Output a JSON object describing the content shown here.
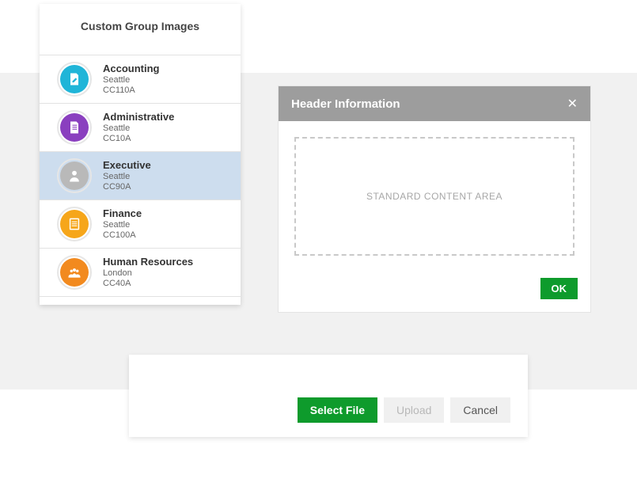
{
  "sidebar": {
    "title": "Custom Group Images",
    "selected_index": 2,
    "items": [
      {
        "name": "Accounting",
        "location": "Seattle",
        "code": "CC110A",
        "icon": "edit-doc",
        "color": "#20b5d8"
      },
      {
        "name": "Administrative",
        "location": "Seattle",
        "code": "CC10A",
        "icon": "document",
        "color": "#8a3fbf"
      },
      {
        "name": "Executive",
        "location": "Seattle",
        "code": "CC90A",
        "icon": "person",
        "color": "#b9b9b9"
      },
      {
        "name": "Finance",
        "location": "Seattle",
        "code": "CC100A",
        "icon": "list",
        "color": "#f6a61a"
      },
      {
        "name": "Human Resources",
        "location": "London",
        "code": "CC40A",
        "icon": "people",
        "color": "#f28a1f"
      }
    ]
  },
  "modal": {
    "title": "Header Information",
    "content_placeholder": "STANDARD CONTENT AREA",
    "ok_label": "OK"
  },
  "bottom": {
    "select_label": "Select File",
    "upload_label": "Upload",
    "cancel_label": "Cancel"
  }
}
